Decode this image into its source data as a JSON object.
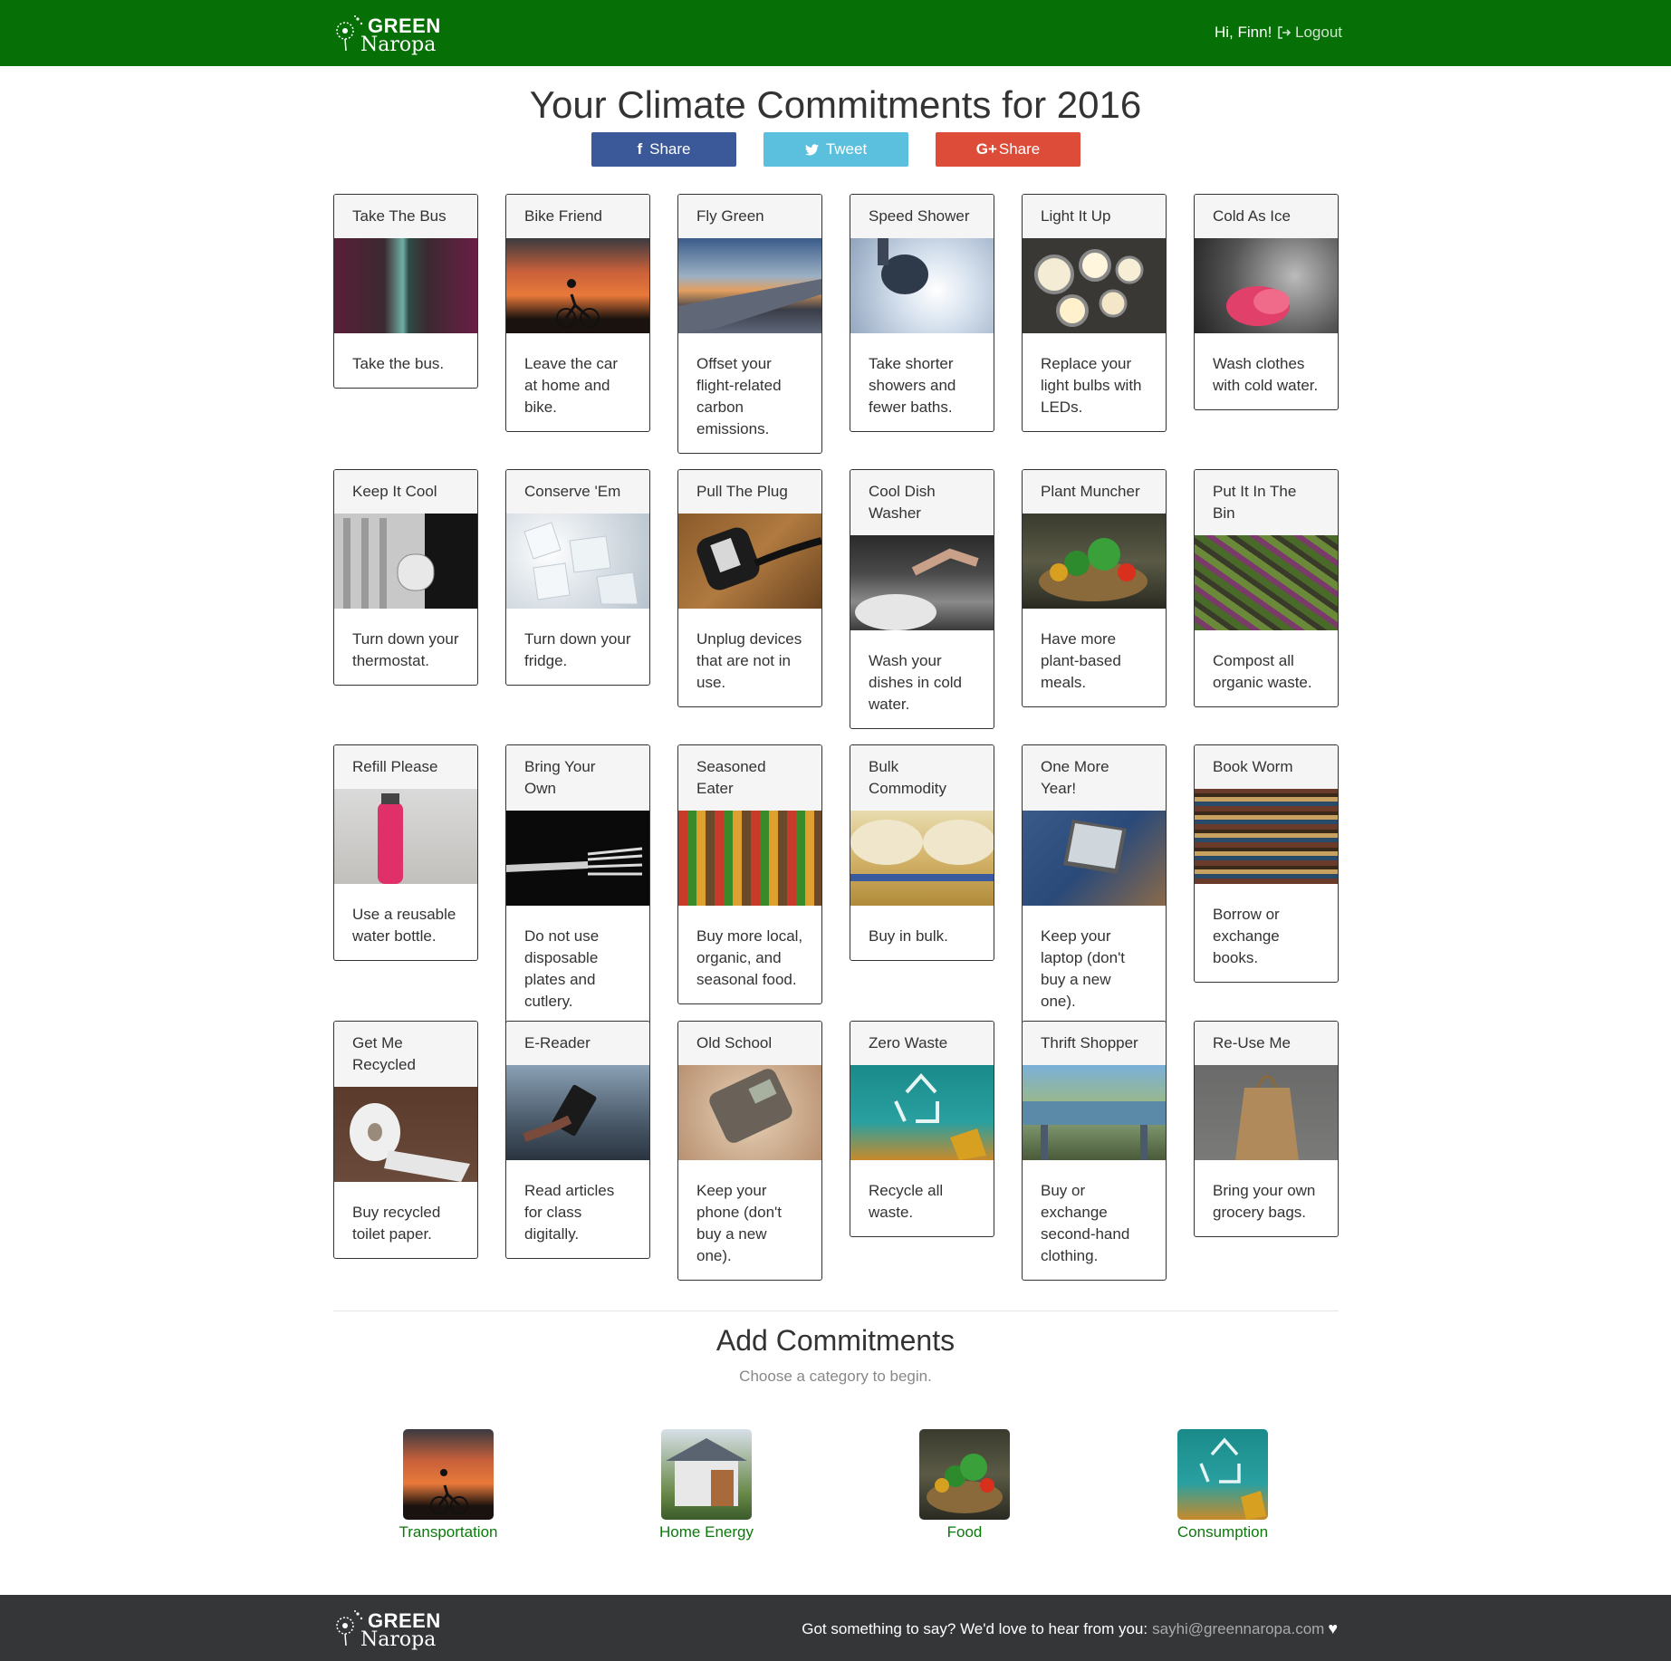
{
  "brand": {
    "line1": "GREEN",
    "line2": "Naropa"
  },
  "header": {
    "greeting": "Hi, Finn!",
    "logout": "Logout"
  },
  "title": "Your Climate Commitments for 2016",
  "share": {
    "facebook": "Share",
    "twitter": "Tweet",
    "google": "Share",
    "google_icon": "G+"
  },
  "cards": [
    {
      "title": "Take The Bus",
      "text": "Take the bus."
    },
    {
      "title": "Bike Friend",
      "text": "Leave the car at home and bike."
    },
    {
      "title": "Fly Green",
      "text": "Offset your flight-related carbon emissions."
    },
    {
      "title": "Speed Shower",
      "text": "Take shorter showers and fewer baths."
    },
    {
      "title": "Light It Up",
      "text": "Replace your light bulbs with LEDs."
    },
    {
      "title": "Cold As Ice",
      "text": "Wash clothes with cold water."
    },
    {
      "title": "Keep It Cool",
      "text": "Turn down your thermostat."
    },
    {
      "title": "Conserve 'Em",
      "text": "Turn down your fridge."
    },
    {
      "title": "Pull The Plug",
      "text": "Unplug devices that are not in use."
    },
    {
      "title": "Cool Dish Washer",
      "text": "Wash your dishes in cold water."
    },
    {
      "title": "Plant Muncher",
      "text": "Have more plant-based meals."
    },
    {
      "title": "Put It In The Bin",
      "text": "Compost all organic waste."
    },
    {
      "title": "Refill Please",
      "text": "Use a reusable water bottle."
    },
    {
      "title": "Bring Your Own",
      "text": "Do not use disposable plates and cutlery."
    },
    {
      "title": "Seasoned Eater",
      "text": "Buy more local, organic, and seasonal food."
    },
    {
      "title": "Bulk Commodity",
      "text": "Buy in bulk."
    },
    {
      "title": "One More Year!",
      "text": "Keep your laptop (don't buy a new one)."
    },
    {
      "title": "Book Worm",
      "text": "Borrow or exchange books."
    },
    {
      "title": "Get Me Recycled",
      "text": "Buy recycled toilet paper."
    },
    {
      "title": "E-Reader",
      "text": "Read articles for class digitally."
    },
    {
      "title": "Old School",
      "text": "Keep your phone (don't buy a new one)."
    },
    {
      "title": "Zero Waste",
      "text": "Recycle all waste."
    },
    {
      "title": "Thrift Shopper",
      "text": "Buy or exchange second-hand clothing."
    },
    {
      "title": "Re-Use Me",
      "text": "Bring your own grocery bags."
    }
  ],
  "add": {
    "title": "Add Commitments",
    "subtitle": "Choose a category to begin."
  },
  "categories": [
    {
      "label": "Transportation"
    },
    {
      "label": "Home Energy"
    },
    {
      "label": "Food"
    },
    {
      "label": "Consumption"
    }
  ],
  "footer": {
    "text": "Got something to say? We'd love to hear from you:",
    "email": "sayhi@greennaropa.com"
  },
  "colors": {
    "header": "#067006",
    "footer": "#353638",
    "facebook": "#3b5998",
    "twitter": "#5bc0de",
    "google": "#dd4b39",
    "link_green": "#0a7a0a"
  }
}
